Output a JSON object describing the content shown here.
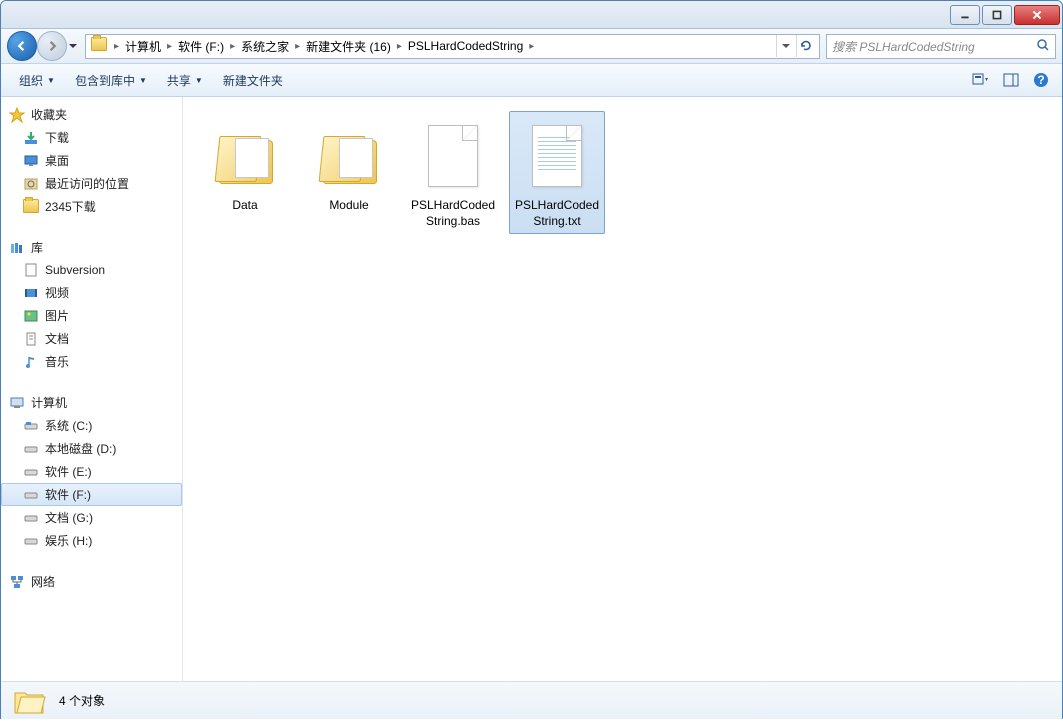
{
  "titlebar": {
    "min": "minimize",
    "max": "maximize",
    "close": "close"
  },
  "breadcrumb": {
    "items": [
      "计算机",
      "软件 (F:)",
      "系统之家",
      "新建文件夹 (16)",
      "PSLHardCodedString"
    ]
  },
  "search": {
    "placeholder": "搜索 PSLHardCodedString"
  },
  "toolbar": {
    "organize": "组织",
    "include": "包含到库中",
    "share": "共享",
    "newfolder": "新建文件夹"
  },
  "sidebar": {
    "favorites": {
      "hdr": "收藏夹",
      "items": [
        "下载",
        "桌面",
        "最近访问的位置",
        "2345下载"
      ]
    },
    "libraries": {
      "hdr": "库",
      "items": [
        "Subversion",
        "视频",
        "图片",
        "文档",
        "音乐"
      ]
    },
    "computer": {
      "hdr": "计算机",
      "items": [
        "系统 (C:)",
        "本地磁盘 (D:)",
        "软件 (E:)",
        "软件 (F:)",
        "文档 (G:)",
        "娱乐 (H:)"
      ],
      "selected": 3
    },
    "network": {
      "hdr": "网络"
    }
  },
  "content": {
    "items": [
      {
        "name": "Data",
        "type": "folder"
      },
      {
        "name": "Module",
        "type": "folder"
      },
      {
        "name": "PSLHardCodedString.bas",
        "type": "file"
      },
      {
        "name": "PSLHardCodedString.txt",
        "type": "txt"
      }
    ],
    "selected": 3
  },
  "status": {
    "count": "4 个对象"
  }
}
